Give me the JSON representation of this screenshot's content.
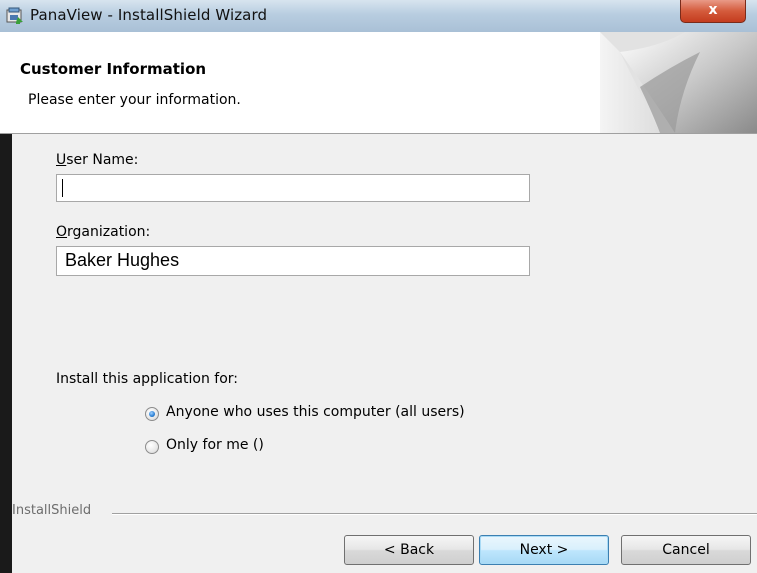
{
  "window": {
    "title": "PanaView - InstallShield Wizard",
    "close_label": "x",
    "icon": "installer-icon"
  },
  "header": {
    "title": "Customer Information",
    "subtitle": "Please enter your information."
  },
  "form": {
    "user_name": {
      "label_accel": "U",
      "label_rest": "ser Name:",
      "value": ""
    },
    "organization": {
      "label_accel": "O",
      "label_rest": "rganization:",
      "value": "Baker Hughes"
    },
    "install_for": {
      "label": "Install this application for:",
      "options": [
        {
          "label": "Anyone who uses this computer (all users)",
          "selected": true
        },
        {
          "label": "Only for me ()",
          "selected": false
        }
      ]
    }
  },
  "footer": {
    "brand": "InstallShield",
    "back_label": "< Back",
    "next_label": "Next >",
    "cancel_label": "Cancel"
  },
  "colors": {
    "accent": "#3c7fb1",
    "close": "#c43c1e"
  }
}
